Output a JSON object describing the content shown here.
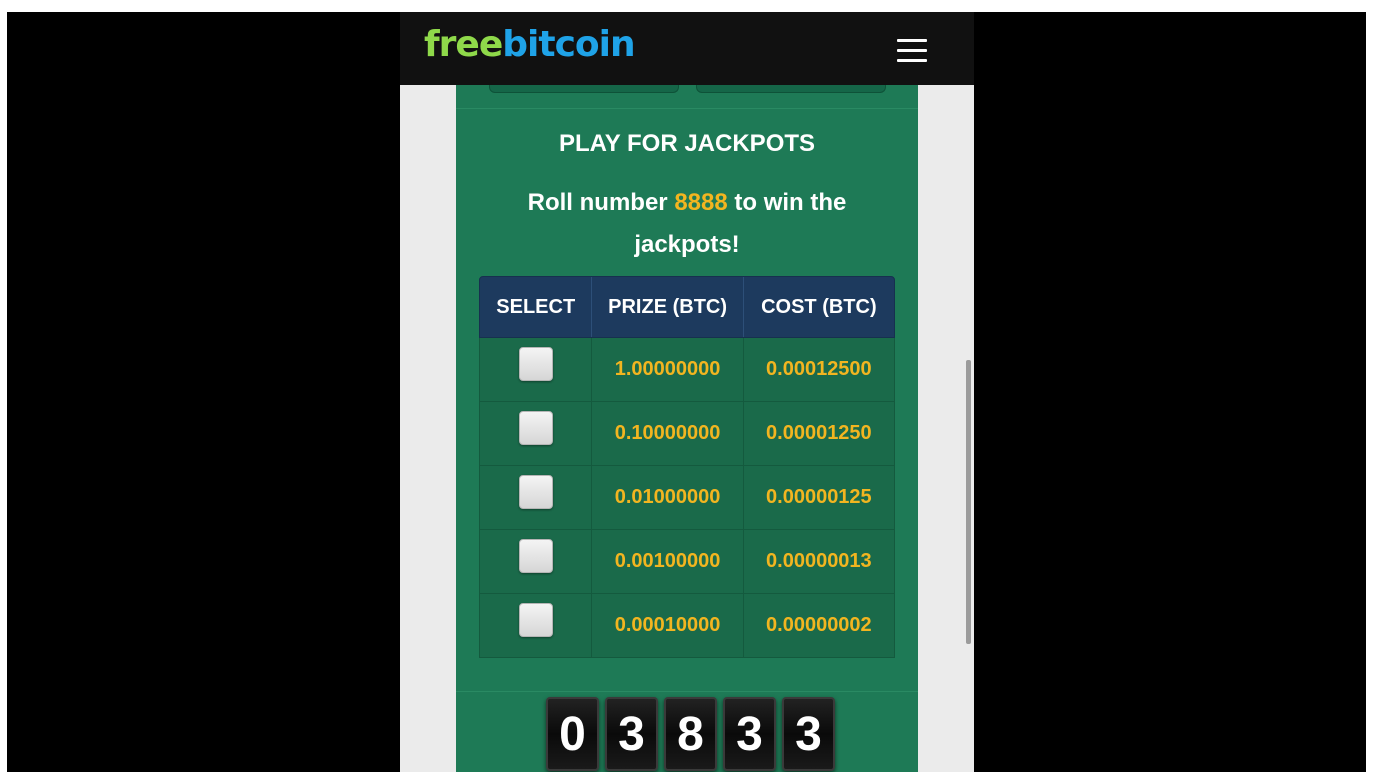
{
  "header": {
    "logo_part1": "free",
    "logo_part2": "bitcoin",
    "menu_icon": "hamburger-menu-icon"
  },
  "jackpot": {
    "heading": "PLAY FOR JACKPOTS",
    "sub_prefix": "Roll number ",
    "sub_number": "8888",
    "sub_suffix": " to win the jackpots!",
    "columns": [
      "SELECT",
      "PRIZE (BTC)",
      "COST (BTC)"
    ],
    "rows": [
      {
        "prize": "1.00000000",
        "cost": "0.00012500"
      },
      {
        "prize": "0.10000000",
        "cost": "0.00001250"
      },
      {
        "prize": "0.01000000",
        "cost": "0.00000125"
      },
      {
        "prize": "0.00100000",
        "cost": "0.00000013"
      },
      {
        "prize": "0.00010000",
        "cost": "0.00000002"
      }
    ]
  },
  "roll_counter": {
    "digits": [
      "0",
      "3",
      "8",
      "3",
      "3"
    ]
  },
  "colors": {
    "panel_green": "#1e7a56",
    "header_navy": "#1d3a5e",
    "accent_gold": "#f2b520",
    "logo_green": "#8fd94a",
    "logo_blue": "#1fa3e8"
  }
}
